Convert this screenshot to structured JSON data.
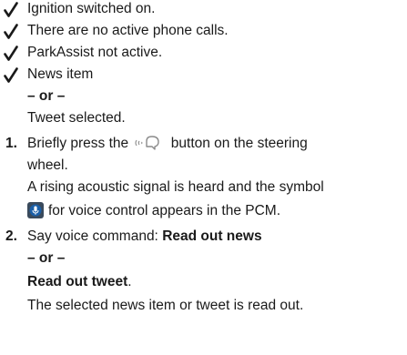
{
  "prereqs": [
    "Ignition switched on.",
    "There are no active phone calls.",
    "ParkAssist not active.",
    "News item"
  ],
  "or1": "– or –",
  "tweet_selected": "Tweet selected.",
  "step1": {
    "number": "1.",
    "text_before": "Briefly press the",
    "text_after": "button on the steering",
    "line2": "wheel.",
    "line3": "A rising acoustic signal is heard and the symbol",
    "line4": "for voice control appears in the PCM."
  },
  "step2": {
    "number": "2.",
    "text": "Say voice command:",
    "cmd1": "Read out news",
    "or2": "– or –",
    "cmd2": "Read out tweet",
    "period": ".",
    "result": "The selected news item or tweet is read out."
  },
  "icons": {
    "check": "checkmark-icon",
    "voice_button": "voice-control-steering-button-icon",
    "voice_symbol": "voice-control-symbol-icon"
  },
  "colors": {
    "text": "#1a1a1a",
    "symbol_bg": "#1b5fa8",
    "icon_gray": "#8a8a8a"
  }
}
